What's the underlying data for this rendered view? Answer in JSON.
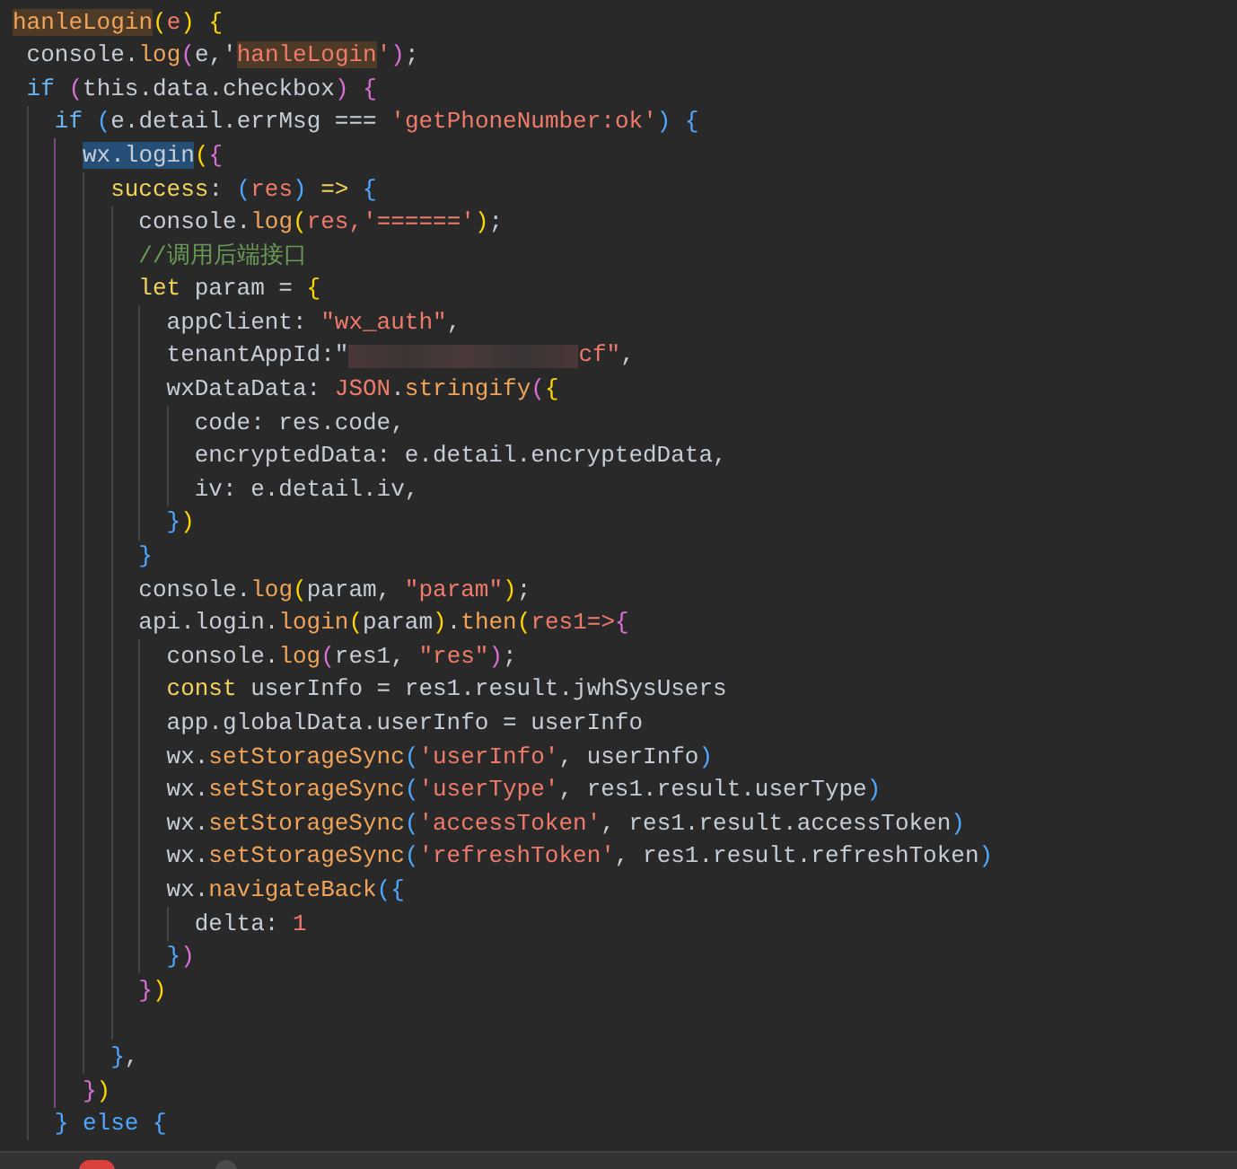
{
  "editor": {
    "lines": [
      {
        "kind": "code",
        "tokens": [
          {
            "text": "hanleLogin",
            "kind": "find"
          },
          {
            "text": "(",
            "kind": "b1"
          },
          {
            "text": "e",
            "kind": "param"
          },
          {
            "text": ") ",
            "kind": "b1"
          },
          {
            "text": "{",
            "kind": "b1"
          }
        ]
      },
      {
        "kind": "code",
        "tokens": [
          {
            "text": " console.",
            "kind": "plain"
          },
          {
            "text": "log",
            "kind": "fn"
          },
          {
            "text": "(",
            "kind": "b2"
          },
          {
            "text": "e,'",
            "kind": "plain"
          },
          {
            "text": "hanleLogin",
            "kind": "strfind"
          },
          {
            "text": "'",
            "kind": "str"
          },
          {
            "text": ")",
            "kind": "b2"
          },
          {
            "text": ";",
            "kind": "plain"
          }
        ]
      },
      {
        "kind": "code",
        "tokens": [
          {
            "text": " if ",
            "kind": "kw"
          },
          {
            "text": "(",
            "kind": "b2"
          },
          {
            "text": "this.data.checkbox",
            "kind": "plain"
          },
          {
            "text": ") ",
            "kind": "b2"
          },
          {
            "text": "{",
            "kind": "b2"
          }
        ]
      },
      {
        "kind": "code",
        "tokens": [
          {
            "text": "   if ",
            "kind": "kw"
          },
          {
            "text": "(",
            "kind": "b3"
          },
          {
            "text": "e.detail.errMsg === ",
            "kind": "plain"
          },
          {
            "text": "'getPhoneNumber:ok'",
            "kind": "str"
          },
          {
            "text": ") ",
            "kind": "b3"
          },
          {
            "text": "{",
            "kind": "b3"
          }
        ]
      },
      {
        "kind": "code",
        "tokens": [
          {
            "text": "     wx.login",
            "kind": "sel"
          },
          {
            "text": "(",
            "kind": "b1"
          },
          {
            "text": "{",
            "kind": "b2"
          }
        ]
      },
      {
        "kind": "code",
        "tokens": [
          {
            "text": "       success",
            "kind": "decl"
          },
          {
            "text": ": ",
            "kind": "plain"
          },
          {
            "text": "(",
            "kind": "b3"
          },
          {
            "text": "res",
            "kind": "param"
          },
          {
            "text": ")",
            "kind": "b3"
          },
          {
            "text": " => ",
            "kind": "decl"
          },
          {
            "text": "{",
            "kind": "b3"
          }
        ]
      },
      {
        "kind": "code",
        "tokens": [
          {
            "text": "         console.",
            "kind": "plain"
          },
          {
            "text": "log",
            "kind": "fn"
          },
          {
            "text": "(",
            "kind": "b1"
          },
          {
            "text": "res,'======'",
            "kind": "str"
          },
          {
            "text": ")",
            "kind": "b1"
          },
          {
            "text": ";",
            "kind": "plain"
          }
        ]
      },
      {
        "kind": "code",
        "tokens": [
          {
            "text": "         //调用后端接口",
            "kind": "comment"
          }
        ]
      },
      {
        "kind": "code",
        "tokens": [
          {
            "text": "         let",
            "kind": "decl"
          },
          {
            "text": " param = ",
            "kind": "plain"
          },
          {
            "text": "{",
            "kind": "b1"
          }
        ]
      },
      {
        "kind": "code",
        "tokens": [
          {
            "text": "           appClient: ",
            "kind": "plain"
          },
          {
            "text": "\"wx_auth\"",
            "kind": "str"
          },
          {
            "text": ",",
            "kind": "plain"
          }
        ]
      },
      {
        "kind": "code",
        "tokens": [
          {
            "text": "           tenantAppId:\"",
            "kind": "plain"
          },
          {
            "kind": "redacted"
          },
          {
            "text": "cf\"",
            "kind": "str"
          },
          {
            "text": ",",
            "kind": "plain"
          }
        ]
      },
      {
        "kind": "code",
        "tokens": [
          {
            "text": "           wxDataData: ",
            "kind": "plain"
          },
          {
            "text": "JSON",
            "kind": "param"
          },
          {
            "text": ".",
            "kind": "plain"
          },
          {
            "text": "stringify",
            "kind": "fn"
          },
          {
            "text": "(",
            "kind": "b2"
          },
          {
            "text": "{",
            "kind": "b1"
          }
        ]
      },
      {
        "kind": "code",
        "tokens": [
          {
            "text": "             code: res.code,",
            "kind": "plain"
          }
        ]
      },
      {
        "kind": "code",
        "tokens": [
          {
            "text": "             encryptedData: e.detail.encryptedData,",
            "kind": "plain"
          }
        ]
      },
      {
        "kind": "code",
        "tokens": [
          {
            "text": "             iv: e.detail.iv,",
            "kind": "plain"
          }
        ]
      },
      {
        "kind": "code",
        "tokens": [
          {
            "text": "           }",
            "kind": "b3"
          },
          {
            "text": ")",
            "kind": "b1"
          }
        ]
      },
      {
        "kind": "code",
        "tokens": [
          {
            "text": "         }",
            "kind": "b3"
          }
        ]
      },
      {
        "kind": "code",
        "tokens": [
          {
            "text": "         console.",
            "kind": "plain"
          },
          {
            "text": "log",
            "kind": "fn"
          },
          {
            "text": "(",
            "kind": "b1"
          },
          {
            "text": "param, ",
            "kind": "plain"
          },
          {
            "text": "\"param\"",
            "kind": "str"
          },
          {
            "text": ")",
            "kind": "b1"
          },
          {
            "text": ";",
            "kind": "plain"
          }
        ]
      },
      {
        "kind": "code",
        "tokens": [
          {
            "text": "         api.login.",
            "kind": "plain"
          },
          {
            "text": "login",
            "kind": "fn"
          },
          {
            "text": "(",
            "kind": "b1"
          },
          {
            "text": "param",
            "kind": "plain"
          },
          {
            "text": ")",
            "kind": "b1"
          },
          {
            "text": ".",
            "kind": "plain"
          },
          {
            "text": "then",
            "kind": "fn"
          },
          {
            "text": "(",
            "kind": "b1"
          },
          {
            "text": "res1=>",
            "kind": "param"
          },
          {
            "text": "{",
            "kind": "b2"
          }
        ]
      },
      {
        "kind": "code",
        "tokens": [
          {
            "text": "           console.",
            "kind": "plain"
          },
          {
            "text": "log",
            "kind": "fn"
          },
          {
            "text": "(",
            "kind": "b2"
          },
          {
            "text": "res1, ",
            "kind": "plain"
          },
          {
            "text": "\"res\"",
            "kind": "str"
          },
          {
            "text": ")",
            "kind": "b2"
          },
          {
            "text": ";",
            "kind": "plain"
          }
        ]
      },
      {
        "kind": "code",
        "tokens": [
          {
            "text": "           const",
            "kind": "decl"
          },
          {
            "text": " userInfo = res1.result.jwhSysUsers",
            "kind": "plain"
          }
        ]
      },
      {
        "kind": "code",
        "tokens": [
          {
            "text": "           app.globalData.userInfo = userInfo",
            "kind": "plain"
          }
        ]
      },
      {
        "kind": "code",
        "tokens": [
          {
            "text": "           wx.",
            "kind": "plain"
          },
          {
            "text": "setStorageSync",
            "kind": "fn"
          },
          {
            "text": "(",
            "kind": "b3"
          },
          {
            "text": "'userInfo'",
            "kind": "str"
          },
          {
            "text": ", userInfo",
            "kind": "plain"
          },
          {
            "text": ")",
            "kind": "b3"
          }
        ]
      },
      {
        "kind": "code",
        "tokens": [
          {
            "text": "           wx.",
            "kind": "plain"
          },
          {
            "text": "setStorageSync",
            "kind": "fn"
          },
          {
            "text": "(",
            "kind": "b3"
          },
          {
            "text": "'userType'",
            "kind": "str"
          },
          {
            "text": ", res1.result.userType",
            "kind": "plain"
          },
          {
            "text": ")",
            "kind": "b3"
          }
        ]
      },
      {
        "kind": "code",
        "tokens": [
          {
            "text": "           wx.",
            "kind": "plain"
          },
          {
            "text": "setStorageSync",
            "kind": "fn"
          },
          {
            "text": "(",
            "kind": "b3"
          },
          {
            "text": "'accessToken'",
            "kind": "str"
          },
          {
            "text": ", res1.result.accessToken",
            "kind": "plain"
          },
          {
            "text": ")",
            "kind": "b3"
          }
        ]
      },
      {
        "kind": "code",
        "tokens": [
          {
            "text": "           wx.",
            "kind": "plain"
          },
          {
            "text": "setStorageSync",
            "kind": "fn"
          },
          {
            "text": "(",
            "kind": "b3"
          },
          {
            "text": "'refreshToken'",
            "kind": "str"
          },
          {
            "text": ", res1.result.refreshToken",
            "kind": "plain"
          },
          {
            "text": ")",
            "kind": "b3"
          }
        ]
      },
      {
        "kind": "code",
        "tokens": [
          {
            "text": "           wx.",
            "kind": "plain"
          },
          {
            "text": "navigateBack",
            "kind": "fn"
          },
          {
            "text": "(",
            "kind": "b3"
          },
          {
            "text": "{",
            "kind": "b3"
          }
        ]
      },
      {
        "kind": "code",
        "tokens": [
          {
            "text": "             delta: ",
            "kind": "plain"
          },
          {
            "text": "1",
            "kind": "param"
          }
        ]
      },
      {
        "kind": "code",
        "tokens": [
          {
            "text": "           }",
            "kind": "b3"
          },
          {
            "text": ")",
            "kind": "b2"
          }
        ]
      },
      {
        "kind": "code",
        "tokens": [
          {
            "text": "         }",
            "kind": "b2"
          },
          {
            "text": ")",
            "kind": "b1"
          }
        ]
      },
      {
        "kind": "blank"
      },
      {
        "kind": "code",
        "tokens": [
          {
            "text": "       }",
            "kind": "b3"
          },
          {
            "text": ",",
            "kind": "plain"
          }
        ]
      },
      {
        "kind": "code",
        "tokens": [
          {
            "text": "     }",
            "kind": "b2"
          },
          {
            "text": ")",
            "kind": "b1"
          }
        ]
      },
      {
        "kind": "code",
        "tokens": [
          {
            "text": "   } else {",
            "kind": "b3"
          }
        ]
      }
    ]
  }
}
